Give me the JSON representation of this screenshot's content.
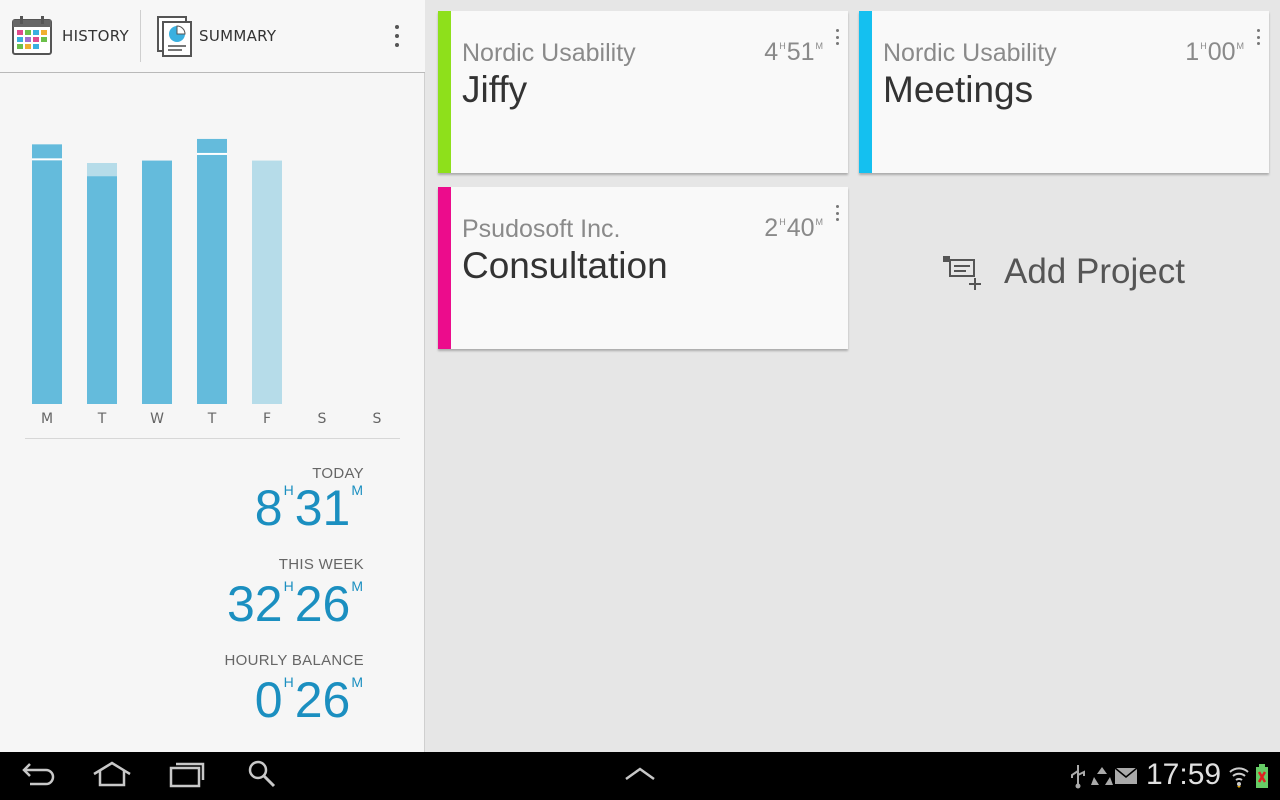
{
  "toolbar": {
    "history_label": "HISTORY",
    "summary_label": "SUMMARY"
  },
  "chart_data": {
    "type": "bar",
    "categories": [
      "M",
      "T",
      "W",
      "T",
      "F",
      "S",
      "S"
    ],
    "series": [
      {
        "values": [
          9.6,
          8.9,
          9.0,
          9.8,
          9.0,
          0,
          0
        ]
      }
    ],
    "colors": {
      "bar": "#64bbdc",
      "bar_light": "#b6dce9",
      "marker": "#ffffff"
    }
  },
  "stats": {
    "today": {
      "label": "TODAY",
      "hours": "8",
      "minutes": "31",
      "h_unit": "H",
      "m_unit": "M"
    },
    "this_week": {
      "label": "THIS WEEK",
      "hours": "32",
      "minutes": "26",
      "h_unit": "H",
      "m_unit": "M"
    },
    "hourly_balance": {
      "label": "HOURLY BALANCE",
      "hours": "0",
      "minutes": "26",
      "h_unit": "H",
      "m_unit": "M"
    }
  },
  "projects": [
    {
      "client": "Nordic Usability",
      "name": "Jiffy",
      "hours": "4",
      "minutes": "51",
      "h_unit": "H",
      "m_unit": "M",
      "color": "#8ee01b"
    },
    {
      "client": "Nordic Usability",
      "name": "Meetings",
      "hours": "1",
      "minutes": "00",
      "h_unit": "H",
      "m_unit": "M",
      "color": "#14c0f0"
    },
    {
      "client": "Psudosoft Inc.",
      "name": "Consultation",
      "hours": "2",
      "minutes": "40",
      "h_unit": "H",
      "m_unit": "M",
      "color": "#ec0c8c"
    }
  ],
  "add_project": {
    "label": "Add Project"
  },
  "statusbar": {
    "time": "17:59"
  }
}
